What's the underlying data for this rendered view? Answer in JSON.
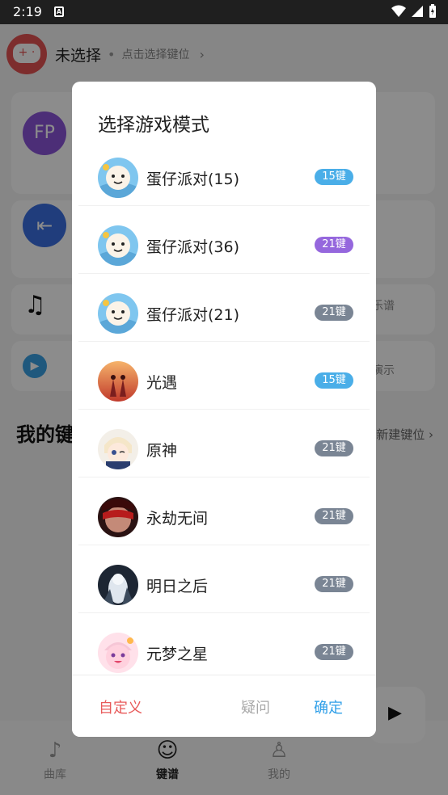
{
  "status_bar": {
    "time": "2:19",
    "a_badge": "A"
  },
  "header": {
    "current": "未选择",
    "hint": "点击选择键位"
  },
  "sections": {
    "my_keys_title": "我的键",
    "new_key": "新建键位",
    "lyre_partial": "乐谱",
    "demo_partial": "演示"
  },
  "nav": {
    "library": "曲库",
    "keys": "键谱",
    "me": "我的"
  },
  "dialog": {
    "title": "选择游戏模式",
    "items": [
      {
        "name": "蛋仔派对(15)",
        "badge": "15键",
        "badge_color": "#4aaee8",
        "avatar_icon": "eggy-party-icon"
      },
      {
        "name": "蛋仔派对(36)",
        "badge": "21键",
        "badge_color": "#9567dd",
        "avatar_icon": "eggy-party-icon"
      },
      {
        "name": "蛋仔派对(21)",
        "badge": "21键",
        "badge_color": "#7a8594",
        "avatar_icon": "eggy-party-icon"
      },
      {
        "name": "光遇",
        "badge": "15键",
        "badge_color": "#4aaee8",
        "avatar_icon": "sky-icon"
      },
      {
        "name": "原神",
        "badge": "21键",
        "badge_color": "#7a8594",
        "avatar_icon": "genshin-icon"
      },
      {
        "name": "永劫无间",
        "badge": "21键",
        "badge_color": "#7a8594",
        "avatar_icon": "naraka-icon"
      },
      {
        "name": "明日之后",
        "badge": "21键",
        "badge_color": "#7a8594",
        "avatar_icon": "lifeafter-icon"
      },
      {
        "name": "元梦之星",
        "badge": "21键",
        "badge_color": "#7a8594",
        "avatar_icon": "dream-star-icon"
      }
    ],
    "buttons": {
      "custom": "自定义",
      "help": "疑问",
      "confirm": "确定"
    }
  }
}
